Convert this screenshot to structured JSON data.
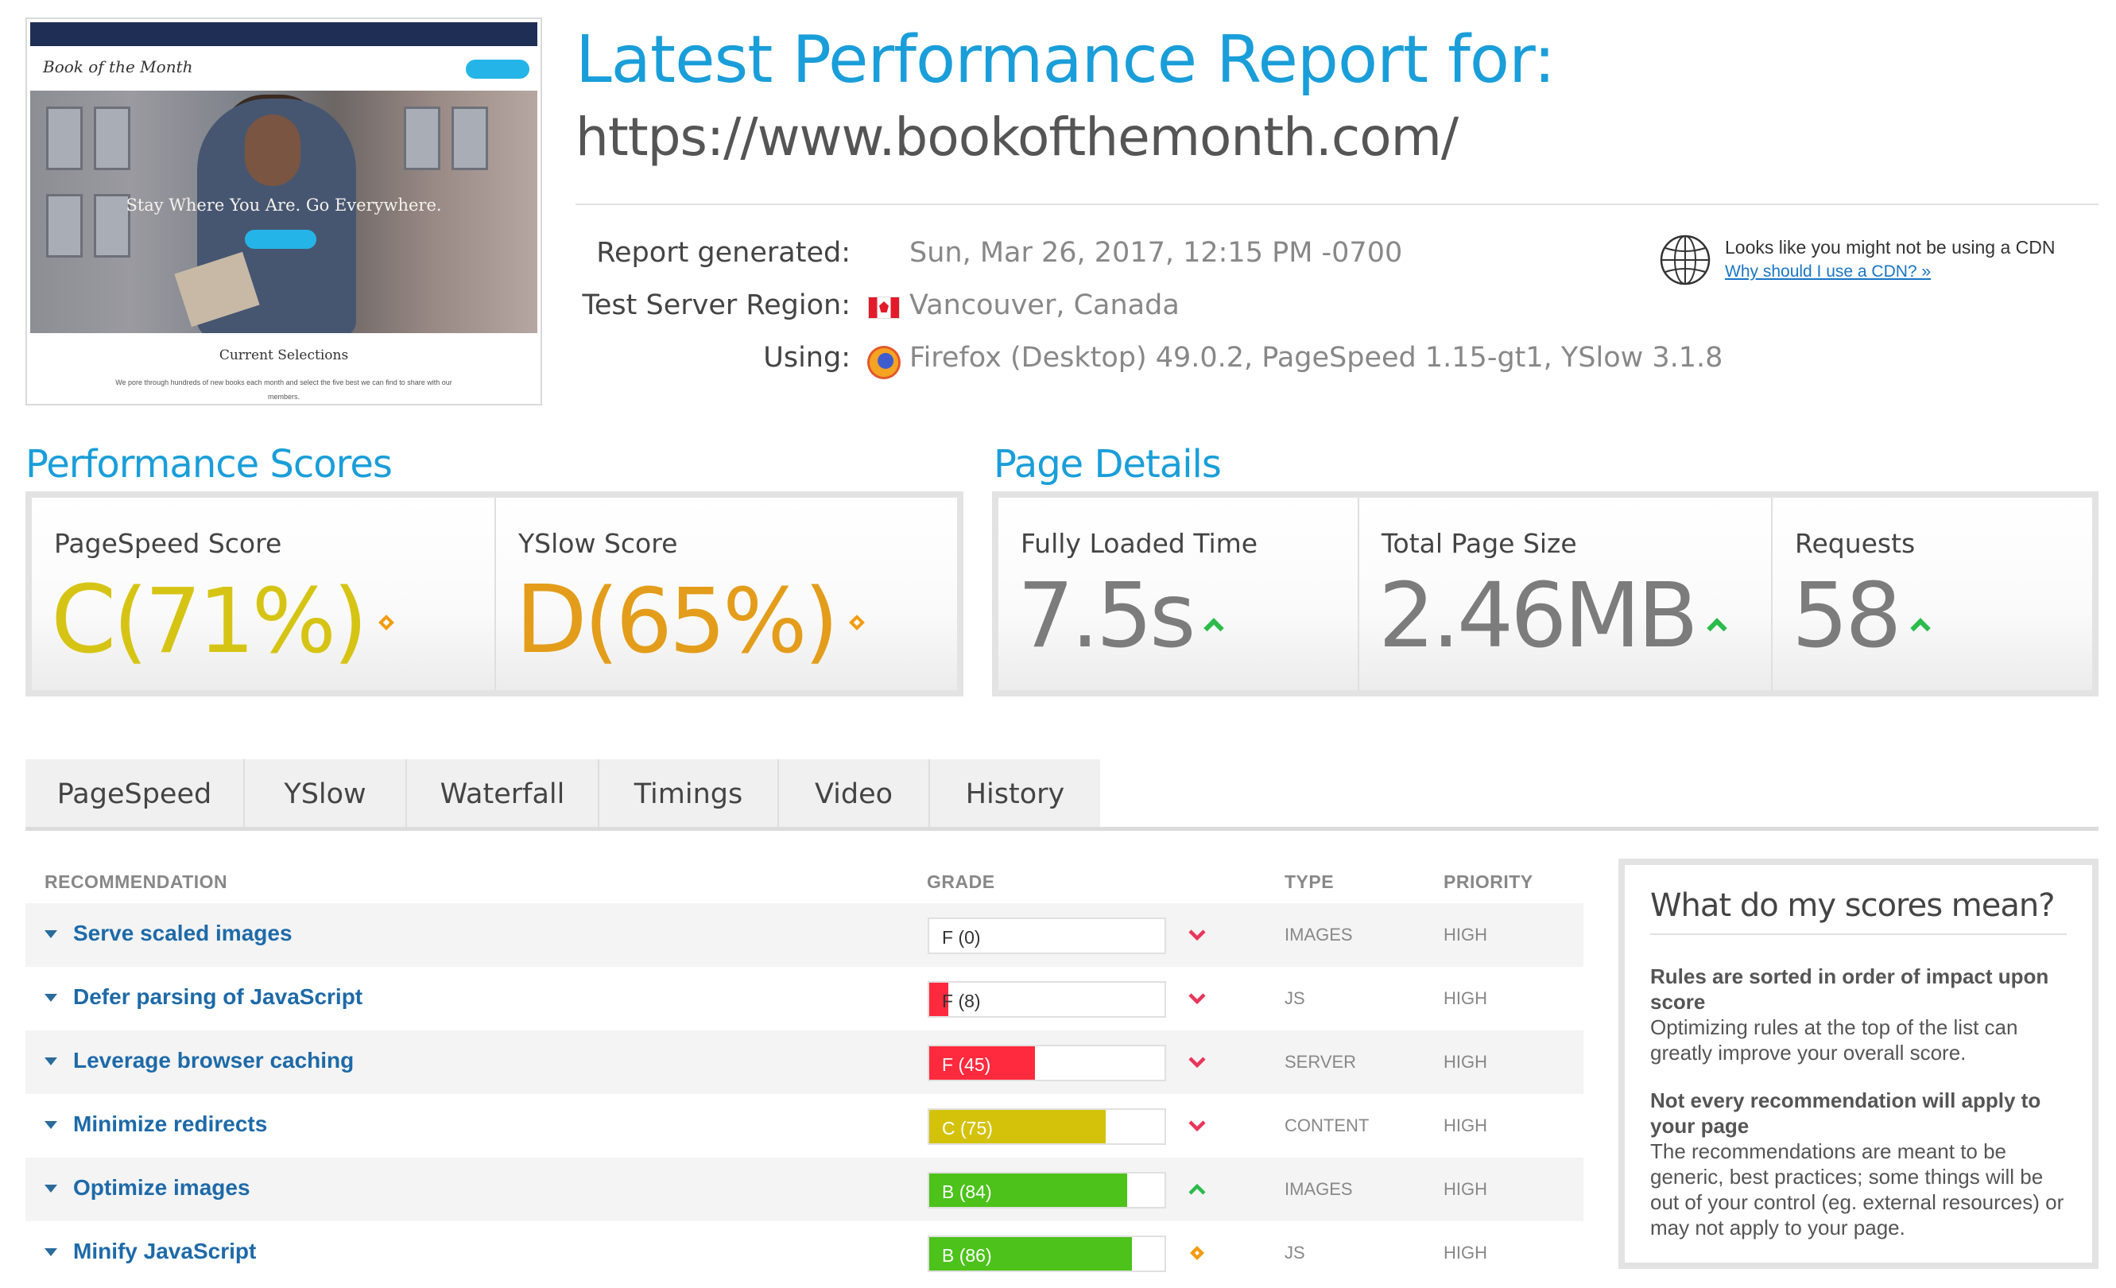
{
  "thumbnail": {
    "logo": "Book of the Month",
    "tagline": "Stay Where You Are. Go Everywhere.",
    "section_title": "Current Selections",
    "section_text": "We pore through hundreds of new books each month and select the five best we can find to share with our members."
  },
  "header": {
    "title": "Latest Performance Report for:",
    "url": "https://www.bookofthemonth.com/"
  },
  "meta": {
    "generated_label": "Report generated:",
    "generated_value": "Sun, Mar 26, 2017, 12:15 PM -0700",
    "region_label": "Test Server Region:",
    "region_value": "Vancouver, Canada",
    "using_label": "Using:",
    "using_value": "Firefox (Desktop) 49.0.2, PageSpeed 1.15-gt1, YSlow 3.1.8"
  },
  "cdn": {
    "icon": "globe-icon",
    "text": "Looks like you might not be using a CDN",
    "link": "Why should I use a CDN? »"
  },
  "performance": {
    "title": "Performance Scores",
    "pagespeed_label": "PageSpeed Score",
    "pagespeed_grade": "C",
    "pagespeed_pct": "(71%)",
    "yslow_label": "YSlow Score",
    "yslow_grade": "D",
    "yslow_pct": "(65%)"
  },
  "details": {
    "title": "Page Details",
    "load_label": "Fully Loaded Time",
    "load_value": "7.5s",
    "size_label": "Total Page Size",
    "size_value": "2.46MB",
    "req_label": "Requests",
    "req_value": "58"
  },
  "tabs": [
    "PageSpeed",
    "YSlow",
    "Waterfall",
    "Timings",
    "Video",
    "History"
  ],
  "table": {
    "headers": {
      "recommendation": "RECOMMENDATION",
      "grade": "GRADE",
      "type": "TYPE",
      "priority": "PRIORITY"
    },
    "rows": [
      {
        "name": "Serve scaled images",
        "grade": "F (0)",
        "score": 0,
        "color": "#ff2a3d",
        "trend": "down",
        "type": "IMAGES",
        "priority": "HIGH"
      },
      {
        "name": "Defer parsing of JavaScript",
        "grade": "F (8)",
        "score": 8,
        "color": "#ff2a3d",
        "trend": "down",
        "type": "JS",
        "priority": "HIGH"
      },
      {
        "name": "Leverage browser caching",
        "grade": "F (45)",
        "score": 45,
        "color": "#ff2a3d",
        "trend": "down",
        "type": "SERVER",
        "priority": "HIGH"
      },
      {
        "name": "Minimize redirects",
        "grade": "C (75)",
        "score": 75,
        "color": "#d4c20a",
        "trend": "down",
        "type": "CONTENT",
        "priority": "HIGH"
      },
      {
        "name": "Optimize images",
        "grade": "B (84)",
        "score": 84,
        "color": "#4cc21a",
        "trend": "up",
        "type": "IMAGES",
        "priority": "HIGH"
      },
      {
        "name": "Minify JavaScript",
        "grade": "B (86)",
        "score": 86,
        "color": "#4cc21a",
        "trend": "same",
        "type": "JS",
        "priority": "HIGH"
      }
    ]
  },
  "explain": {
    "title": "What do my scores mean?",
    "h1": "Rules are sorted in order of impact upon score",
    "p1": "Optimizing rules at the top of the list can greatly improve your overall score.",
    "h2": "Not every recommendation will apply to your page",
    "p2": "The recommendations are meant to be generic, best practices; some things will be out of your control (eg. external resources) or may not apply to your page."
  },
  "colors": {
    "brand": "#1a9ed9",
    "grade_c": "#d6c414",
    "grade_d": "#e39d1a",
    "trend_up": "#2cbb4c",
    "trend_down": "#e8365a",
    "neutral": "#f39c12"
  }
}
